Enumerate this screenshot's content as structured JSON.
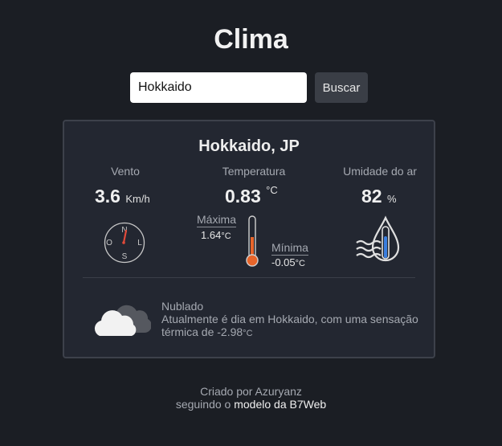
{
  "header": {
    "title": "Clima"
  },
  "search": {
    "value": "Hokkaido",
    "button_label": "Buscar"
  },
  "weather": {
    "location": "Hokkaido, JP",
    "wind": {
      "label": "Vento",
      "value": "3.6",
      "unit": "Km/h",
      "compass": {
        "n": "N",
        "s": "S",
        "e": "L",
        "w": "O"
      }
    },
    "temperature": {
      "label": "Temperatura",
      "value": "0.83",
      "unit": "°C",
      "max_label": "Máxima",
      "max_value": "1.64",
      "max_unit": "°C",
      "min_label": "Mínima",
      "min_value": "-0.05",
      "min_unit": "°C"
    },
    "humidity": {
      "label": "Umidade do ar",
      "value": "82",
      "unit": "%"
    },
    "condition": {
      "title": "Nublado",
      "line1": "Atualmente é dia em Hokkaido, com uma sensação",
      "line2": "térmica de -2.98",
      "line2_unit": "°C"
    }
  },
  "footer": {
    "line1": "Criado por Azuryanz",
    "line2_prefix": "seguindo o",
    "line2_link": "modelo da B7Web"
  },
  "colors": {
    "background": "#1b1e24",
    "card": "#232731",
    "thermo": "#e8652a",
    "drop": "#3a7ee0"
  },
  "icons": [
    "compass-icon",
    "thermometer-icon",
    "humidity-drop-icon",
    "cloud-icon"
  ]
}
